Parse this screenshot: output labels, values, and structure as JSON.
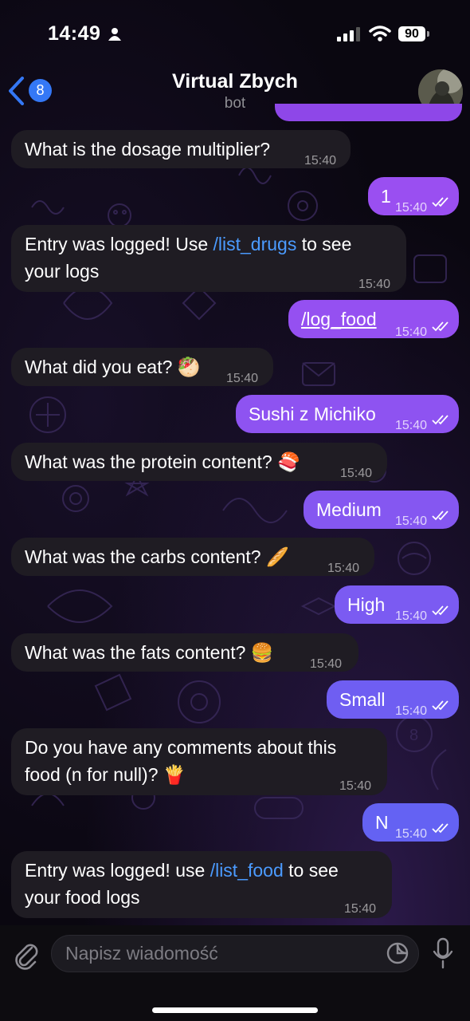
{
  "status_bar": {
    "time": "14:49",
    "battery": "90"
  },
  "header": {
    "back_count": "8",
    "title": "Virtual Zbych",
    "subtitle": "bot"
  },
  "messages": [
    {
      "text": "What is the dosage multiplier?",
      "time": "15:40"
    },
    {
      "text": "1",
      "time": "15:40"
    },
    {
      "text_before": "Entry was logged! Use ",
      "link": "/list_drugs",
      "text_after1": " to see",
      "text_after2": "your logs",
      "time": "15:40"
    },
    {
      "text": "/log_food",
      "time": "15:40"
    },
    {
      "text": "What did you eat? 🥙",
      "time": "15:40"
    },
    {
      "text": "Sushi z Michiko",
      "time": "15:40"
    },
    {
      "text": "What was the protein content? 🍣",
      "time": "15:40"
    },
    {
      "text": "Medium",
      "time": "15:40"
    },
    {
      "text": "What was the carbs content? 🥖",
      "time": "15:40"
    },
    {
      "text": "High",
      "time": "15:40"
    },
    {
      "text": "What was the fats content? 🍔",
      "time": "15:40"
    },
    {
      "text": "Small",
      "time": "15:40"
    },
    {
      "line1": "Do you have any comments about this",
      "line2": "food (n for null)? 🍟",
      "time": "15:40"
    },
    {
      "text": "N",
      "time": "15:40"
    },
    {
      "text_before": "Entry was logged! use ",
      "link": "/list_food",
      "text_after1": " to see",
      "text_after2": "your food logs",
      "time": "15:40"
    }
  ],
  "composer": {
    "placeholder": "Napisz wiadomość"
  },
  "colors": {
    "outgoing_top": "#9b4ff0",
    "outgoing_bottom": "#4f5cf2",
    "incoming": "#1f1c23",
    "link": "#4b9bff"
  },
  "icons": [
    "person-icon",
    "signal-icon",
    "wifi-icon",
    "battery-icon",
    "back-chevron-icon",
    "avatar",
    "read-ticks-icon",
    "attach-icon",
    "sticker-icon",
    "mic-icon"
  ]
}
